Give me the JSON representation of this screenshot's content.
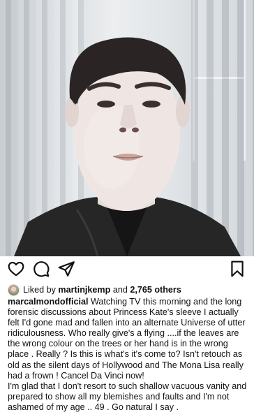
{
  "post": {
    "photo": {
      "subject_icon": "selfie-photo"
    },
    "actions": {
      "like_icon": "heart-outline-icon",
      "comment_icon": "comment-bubble-icon",
      "share_icon": "paper-plane-icon",
      "save_icon": "bookmark-icon"
    },
    "likes": {
      "prefix": "Liked by",
      "user": "martinjkemp",
      "connector": "and",
      "others": "2,765 others"
    },
    "caption": {
      "username": "marcalmondofficial",
      "paragraph1": "Watching TV this morning and the long forensic discussions about Princess Kate's sleeve I actually felt I'd gone mad and fallen into an alternate Universe of utter ridiculousness. Who really give's a flying ....if the leaves are the wrong colour on the trees or her hand is in the wrong place . Really ? Is this is what's it's come to? Isn't retouch as old as the silent days of Hollywood and The Mona Lisa really had a frown ! Cancel Da Vinci now!",
      "paragraph2": "I'm glad that I don't resort to such  shallow vacuous vanity and prepared to show all my blemishes and faults and I'm not ashamed of my age .. 49 . Go natural I say ."
    },
    "colors": {
      "text": "#111111",
      "background": "#ffffff",
      "icon": "#111111"
    }
  }
}
